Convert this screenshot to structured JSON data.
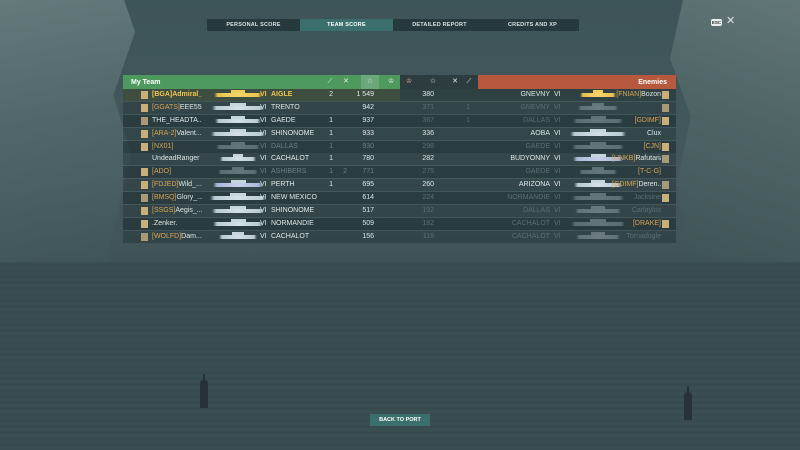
{
  "tabs": [
    {
      "label": "PERSONAL SCORE",
      "active": false
    },
    {
      "label": "TEAM SCORE",
      "active": true
    },
    {
      "label": "DETAILED REPORT",
      "active": false
    },
    {
      "label": "CREDITS AND XP",
      "active": false
    }
  ],
  "esc_label": "ESC",
  "my_team": {
    "title": "My Team",
    "columns_icons": [
      "torpedo-icon",
      "swords-icon",
      "star-icon",
      "laurel-icon"
    ]
  },
  "enemies": {
    "title": "Enemies",
    "columns_icons": [
      "laurel-icon",
      "star-icon",
      "swords-icon",
      "torpedo-icon"
    ]
  },
  "my_team_rows": [
    {
      "tag": "[BGA]",
      "name": "Admiral_...",
      "tier": "VI",
      "ship": "AIGLE",
      "c1": "2",
      "c2": "",
      "score": "1 549",
      "highlight": true,
      "alive": true
    },
    {
      "tag": "[GGATS]",
      "name": "EEE557",
      "tier": "VI",
      "ship": "TRENTO",
      "c1": "",
      "c2": "",
      "score": "942",
      "alive": true
    },
    {
      "tag": "",
      "name": "THE_HEADTA...",
      "tier": "VI",
      "ship": "GAEDE",
      "c1": "1",
      "c2": "",
      "score": "937",
      "alive": true
    },
    {
      "tag": "[ARA-2]",
      "name": "Valent...",
      "tier": "VI",
      "ship": "SHINONOME",
      "c1": "1",
      "c2": "",
      "score": "933",
      "alive": true
    },
    {
      "tag": "[NX01]",
      "name": "",
      "tier": "VI",
      "ship": "DALLAS",
      "c1": "1",
      "c2": "",
      "score": "930",
      "alive": false
    },
    {
      "tag": "",
      "name": "UndeadRanger",
      "tier": "VI",
      "ship": "CACHALOT",
      "c1": "1",
      "c2": "",
      "score": "780",
      "alive": true
    },
    {
      "tag": "[ADO]",
      "name": "",
      "tier": "VI",
      "ship": "ASHIBERS",
      "c1": "1",
      "c2": "2",
      "score": "771",
      "alive": false
    },
    {
      "tag": "[FDJED]",
      "name": "Wild_...",
      "tier": "VI",
      "ship": "PERTH",
      "c1": "1",
      "c2": "",
      "score": "695",
      "alive": true
    },
    {
      "tag": "[BMSQ]",
      "name": "Glory_...",
      "tier": "VI",
      "ship": "NEW MEXICO",
      "c1": "",
      "c2": "",
      "score": "614",
      "alive": true
    },
    {
      "tag": "[SSGS]",
      "name": "Aegis_...",
      "tier": "VI",
      "ship": "SHINONOME",
      "c1": "",
      "c2": "",
      "score": "517",
      "alive": true
    },
    {
      "tag": "",
      "name": ".Zenker.",
      "tier": "VI",
      "ship": "NORMANDIE",
      "c1": "",
      "c2": "",
      "score": "509",
      "alive": true
    },
    {
      "tag": "[WOLFD]",
      "name": "Dam...",
      "tier": "VI",
      "ship": "CACHALOT",
      "c1": "",
      "c2": "",
      "score": "156",
      "alive": true
    }
  ],
  "enemy_rows": [
    {
      "score": "380",
      "c2": "",
      "c1": "",
      "ship": "GNEVNY",
      "tier": "VI",
      "tag": "[FNIAN]",
      "name": "Bozon",
      "alive": true
    },
    {
      "score": "371",
      "c2": "",
      "c1": "1",
      "ship": "GNEVNY",
      "tier": "VI",
      "tag": "",
      "name": "",
      "alive": false
    },
    {
      "score": "367",
      "c2": "",
      "c1": "1",
      "ship": "DALLAS",
      "tier": "VI",
      "tag": "[GDIMF]",
      "name": "",
      "alive": false
    },
    {
      "score": "336",
      "c2": "",
      "c1": "",
      "ship": "AOBA",
      "tier": "VI",
      "tag": "",
      "name": "Clux",
      "alive": true
    },
    {
      "score": "298",
      "c2": "",
      "c1": "",
      "ship": "GAEDE",
      "tier": "VI",
      "tag": "[CJN]",
      "name": "",
      "alive": false
    },
    {
      "score": "282",
      "c2": "",
      "c1": "",
      "ship": "BUDYONNY",
      "tier": "VI",
      "tag": "[UNKB]",
      "name": "Rafutaria",
      "alive": true
    },
    {
      "score": "275",
      "c2": "",
      "c1": "",
      "ship": "GAEDE",
      "tier": "VI",
      "tag": "[T-C-G]",
      "name": "",
      "alive": false
    },
    {
      "score": "260",
      "c2": "",
      "c1": "",
      "ship": "ARIZONA",
      "tier": "VI",
      "tag": "[GDIMF]",
      "name": "Deren...",
      "alive": true
    },
    {
      "score": "224",
      "c2": "",
      "c1": "",
      "ship": "NORMANDIE",
      "tier": "VI",
      "tag": "",
      "name": "Jacksine",
      "alive": false
    },
    {
      "score": "192",
      "c2": "",
      "c1": "",
      "ship": "DALLAS",
      "tier": "VI",
      "tag": "",
      "name": "Carlaylos",
      "alive": false
    },
    {
      "score": "182",
      "c2": "",
      "c1": "",
      "ship": "CACHALOT",
      "tier": "VI",
      "tag": "[DRAKE]",
      "name": "",
      "alive": false
    },
    {
      "score": "119",
      "c2": "",
      "c1": "",
      "ship": "CACHALOT",
      "tier": "VI",
      "tag": "",
      "name": "Tornadogle",
      "alive": false
    }
  ],
  "back_button": "BACK TO PORT"
}
